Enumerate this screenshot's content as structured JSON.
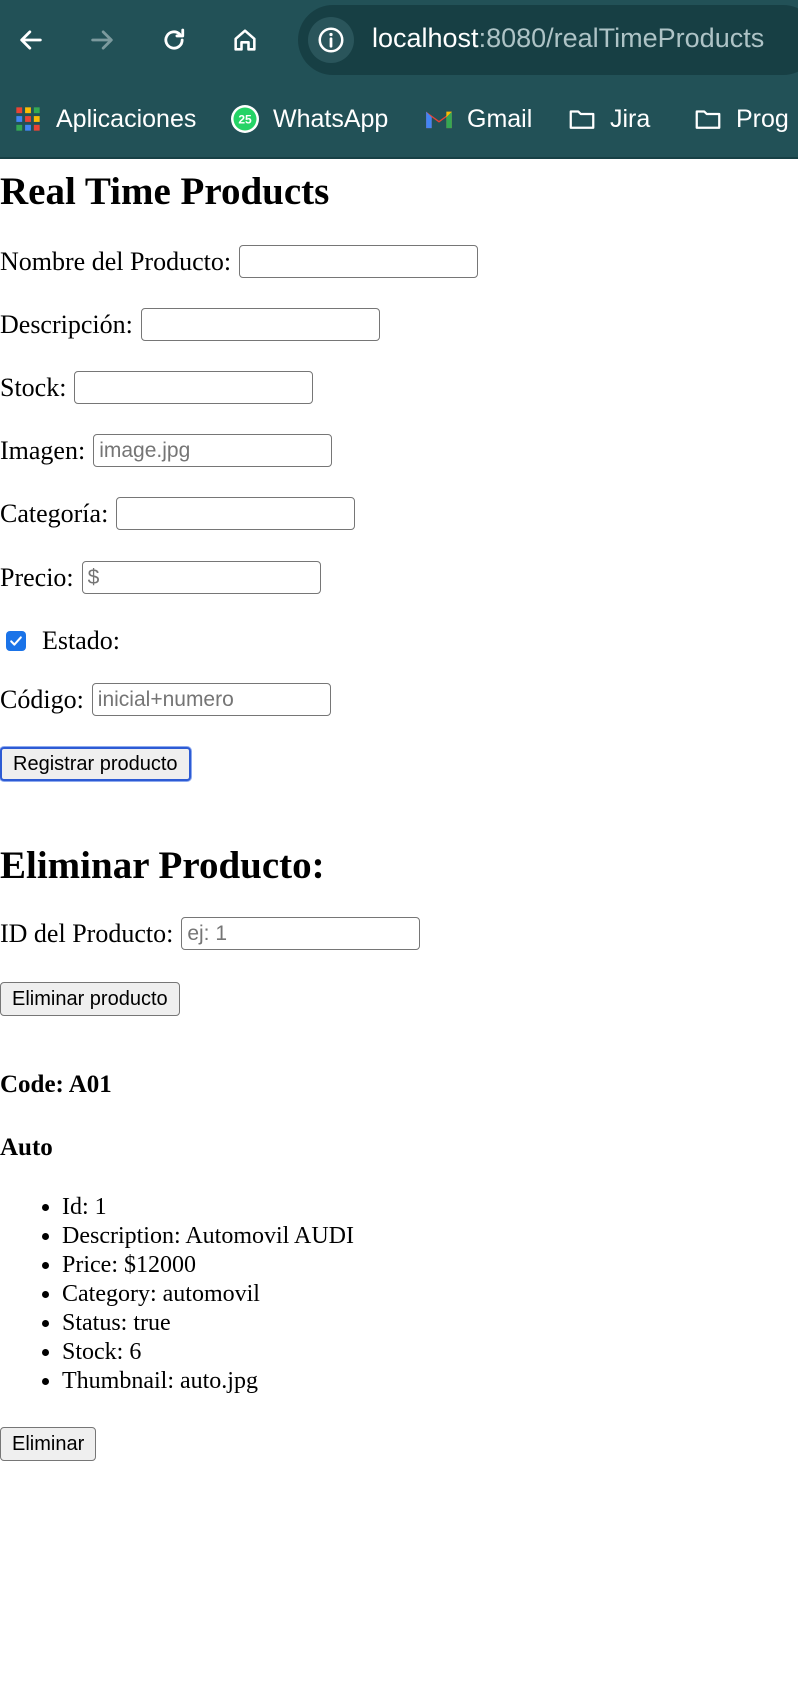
{
  "browser": {
    "url_host": "localhost",
    "url_rest": ":8080/realTimeProducts",
    "bookmarks": [
      {
        "label": "Aplicaciones",
        "icon": "apps-grid-icon"
      },
      {
        "label": "WhatsApp",
        "icon": "whatsapp-icon",
        "badge": "25"
      },
      {
        "label": "Gmail",
        "icon": "gmail-icon"
      },
      {
        "label": "Jira",
        "icon": "folder-icon"
      },
      {
        "label": "Prog",
        "icon": "folder-icon"
      }
    ],
    "colors": {
      "toolbar": "#225157",
      "urlbar": "#173f44"
    }
  },
  "page": {
    "title": "Real Time Products",
    "form": {
      "nombre_label": "Nombre del Producto:",
      "nombre_value": "",
      "descripcion_label": "Descripción:",
      "descripcion_value": "",
      "stock_label": "Stock:",
      "stock_value": "",
      "imagen_label": "Imagen:",
      "imagen_placeholder": "image.jpg",
      "categoria_label": "Categoría:",
      "categoria_value": "",
      "precio_label": "Precio:",
      "precio_placeholder": "$",
      "estado_label": "Estado:",
      "estado_checked": true,
      "codigo_label": "Código:",
      "codigo_placeholder": "inicial+numero",
      "submit_label": "Registrar producto"
    },
    "delete_section": {
      "title": "Eliminar Producto:",
      "id_label": "ID del Producto:",
      "id_placeholder": "ej: 1",
      "button_label": "Eliminar producto"
    },
    "product": {
      "code": "Code: A01",
      "title": "Auto",
      "details": [
        "Id: 1",
        "Description: Automovil AUDI",
        "Price: $12000",
        "Category: automovil",
        "Status: true",
        "Stock: 6",
        "Thumbnail: auto.jpg"
      ],
      "delete_label": "Eliminar"
    }
  }
}
